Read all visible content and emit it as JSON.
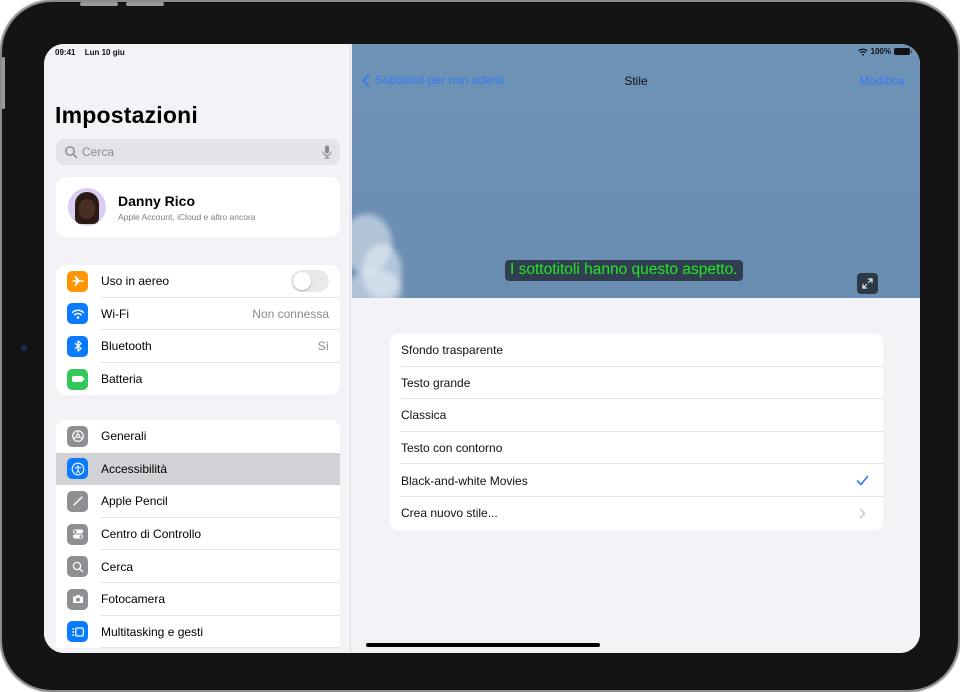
{
  "status_bar": {
    "time": "09:41",
    "date": "Lun 10 giu",
    "battery": "100%"
  },
  "sidebar": {
    "title": "Impostazioni",
    "search": {
      "placeholder": "Cerca"
    },
    "profile": {
      "name": "Danny Rico",
      "subtitle": "Apple Account, iCloud e altro ancora"
    },
    "group1": [
      {
        "label": "Uso in aereo",
        "icon": "airplane-icon",
        "color": "#ff9500",
        "toggle": false
      },
      {
        "label": "Wi-Fi",
        "icon": "wifi-icon",
        "color": "#0a7aff",
        "value": "Non connessa"
      },
      {
        "label": "Bluetooth",
        "icon": "bluetooth-icon",
        "color": "#0a7aff",
        "value": "Sì"
      },
      {
        "label": "Batteria",
        "icon": "battery-icon",
        "color": "#34c759"
      }
    ],
    "group2": [
      {
        "label": "Generali",
        "icon": "gear-icon",
        "color": "#8e8e93"
      },
      {
        "label": "Accessibilità",
        "icon": "accessibility-icon",
        "color": "#0a7aff",
        "selected": true
      },
      {
        "label": "Apple Pencil",
        "icon": "pencil-icon",
        "color": "#8e8e93"
      },
      {
        "label": "Centro di Controllo",
        "icon": "control-center-icon",
        "color": "#8e8e93"
      },
      {
        "label": "Cerca",
        "icon": "search-icon",
        "color": "#8e8e93"
      },
      {
        "label": "Fotocamera",
        "icon": "camera-icon",
        "color": "#8e8e93"
      },
      {
        "label": "Multitasking e gesti",
        "icon": "multitasking-icon",
        "color": "#0a7aff"
      }
    ]
  },
  "detail": {
    "back_label": "Sottotitoli per non udenti",
    "title": "Stile",
    "edit_label": "Modifica",
    "caption_preview": "I sottotitoli hanno questo aspetto.",
    "styles": [
      {
        "label": "Sfondo trasparente"
      },
      {
        "label": "Testo grande"
      },
      {
        "label": "Classica"
      },
      {
        "label": "Testo con contorno"
      },
      {
        "label": "Black-and-white Movies",
        "checked": true
      },
      {
        "label": "Crea nuovo stile...",
        "disclosure": true
      }
    ]
  },
  "colors": {
    "accent": "#2f7cf6",
    "caption_text": "#26e626",
    "selected_row": "#d1d1d6"
  }
}
